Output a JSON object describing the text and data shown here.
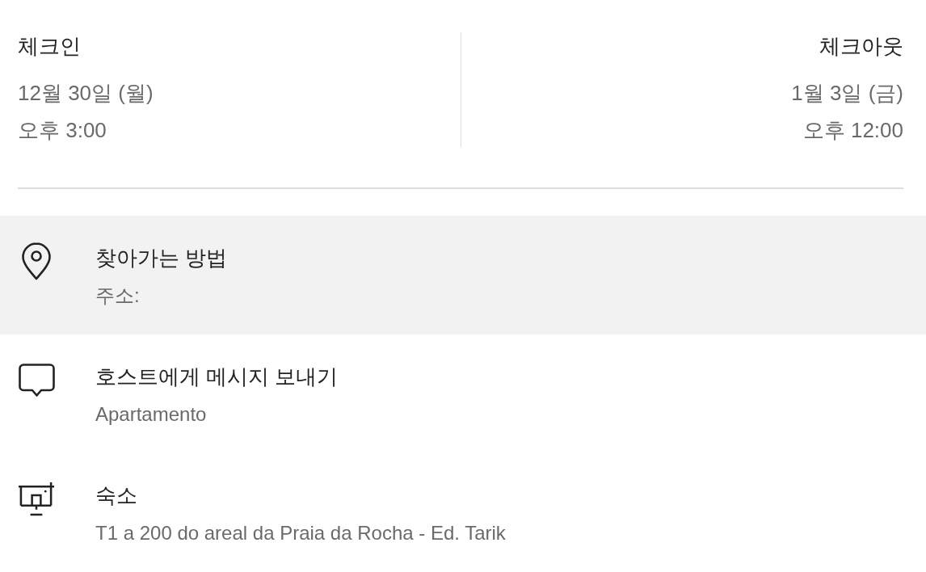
{
  "check_in": {
    "label": "체크인",
    "date": "12월 30일 (월)",
    "time": "오후 3:00"
  },
  "check_out": {
    "label": "체크아웃",
    "date": "1월 3일 (금)",
    "time": "오후 12:00"
  },
  "rows": [
    {
      "kind": "directions",
      "title": "찾아가는 방법",
      "subtitle": "주소:",
      "selected": true
    },
    {
      "kind": "message",
      "title": "호스트에게 메시지 보내기",
      "subtitle": "Apartamento",
      "selected": false
    },
    {
      "kind": "listing",
      "title": "숙소",
      "subtitle": "T1 a 200 do areal da Praia da Rocha - Ed. Tarik",
      "selected": false
    }
  ]
}
